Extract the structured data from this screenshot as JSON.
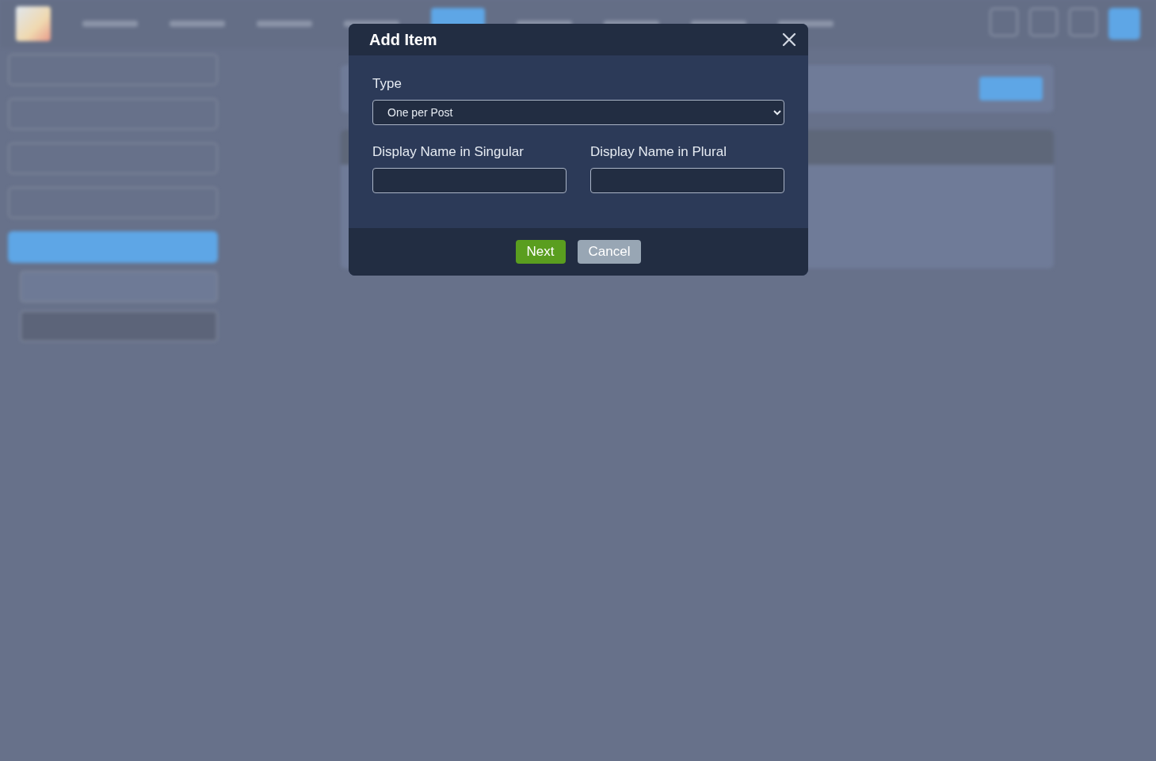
{
  "dialog": {
    "title": "Add Item",
    "type_field": {
      "label": "Type",
      "value": "One per Post"
    },
    "singular_field": {
      "label": "Display Name in Singular"
    },
    "plural_field": {
      "label": "Display Name in Plural"
    },
    "buttons": [
      {
        "label": "Next",
        "kind": "primary"
      },
      {
        "label": "Cancel",
        "kind": "secondary"
      }
    ]
  },
  "sidebar": {
    "items": [
      {
        "selected": false
      },
      {
        "selected": false
      },
      {
        "selected": false
      },
      {
        "selected": false
      },
      {
        "selected": true
      }
    ],
    "sub_items": [
      {
        "selected": false
      },
      {
        "selected": true
      }
    ]
  }
}
